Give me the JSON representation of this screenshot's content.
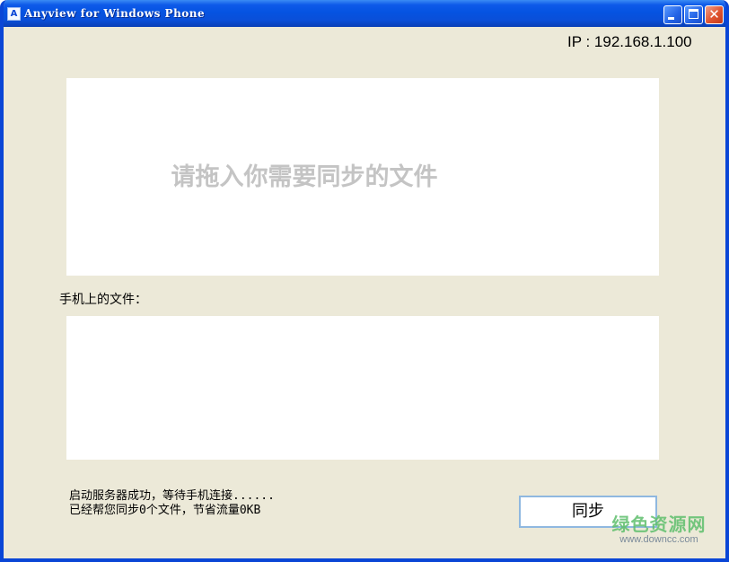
{
  "window": {
    "title": "Anyview for Windows Phone",
    "app_icon_glyph": "A",
    "controls": {
      "minimize": "minimize-icon",
      "maximize": "maximize-icon",
      "close": "close-icon",
      "close_glyph": "✕"
    }
  },
  "header": {
    "ip": "IP : 192.168.1.100"
  },
  "dropzone": {
    "hint": "请拖入你需要同步的文件"
  },
  "phone_files": {
    "label": "手机上的文件："
  },
  "status": {
    "line1": "启动服务器成功，等待手机连接......",
    "line2": "已经帮您同步0个文件，节省流量0KB"
  },
  "sync_button": {
    "label": "同步"
  },
  "watermark": {
    "text": "绿色资源网",
    "url": "www.downcc.com"
  },
  "colors": {
    "title_bar": "#0553e1",
    "window_bg": "#ece9d8",
    "hint_text": "#c4c4c4",
    "button_border": "#8fb8e0"
  }
}
